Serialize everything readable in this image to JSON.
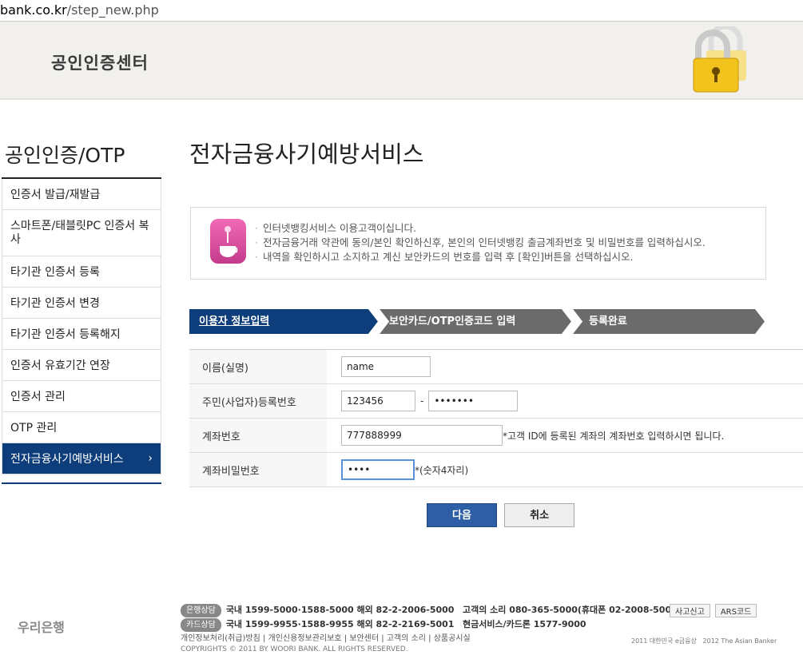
{
  "url": {
    "host": "bank.co.kr",
    "path": "/step_new.php"
  },
  "header": {
    "title": "공인인증센터"
  },
  "sidebar": {
    "title": "공인인증/OTP",
    "items": [
      "인증서 발급/재발급",
      "스마트폰/태블릿PC 인증서 복사",
      "타기관 인증서 등록",
      "타기관 인증서 변경",
      "타기관 인증서 등록해지",
      "인증서 유효기간 연장",
      "인증서 관리",
      "OTP 관리",
      "전자금융사기예방서비스"
    ]
  },
  "page": {
    "title": "전자금융사기예방서비스"
  },
  "info": {
    "lines": [
      "인터넷뱅킹서비스 이용고객이십니다.",
      "전자금융거래 약관에 동의/본인 확인하신후, 본인의 인터넷뱅킹 출금계좌번호 및 비밀번호를 입력하십시오.",
      "내역을 확인하시고 소지하고 계신 보안카드의 번호를 입력 후 [확인]버튼을 선택하십시오."
    ]
  },
  "steps": [
    "이용자 정보입력",
    "보안카드/OTP인증코드 입력",
    "등록완료"
  ],
  "form": {
    "name_label": "이름(실명)",
    "name_value": "name",
    "rrn_label": "주민(사업자)등록번호",
    "rrn_front": "123456",
    "rrn_sep": "-",
    "rrn_back": "•••••••",
    "account_label": "계좌번호",
    "account_value": "777888999",
    "account_note": "*고객 ID에 등록된 계좌의 계좌번호 입력하시면 됩니다.",
    "password_label": "계좌비밀번호",
    "password_value": "••••",
    "password_note": "*(숫자4자리)"
  },
  "buttons": {
    "next": "다음",
    "cancel": "취소"
  },
  "footer": {
    "logo": "우리은행",
    "bank_pill": "은행상담",
    "bank_line": "국내 1599-5000·1588-5000  해외 82-2-2006-5000",
    "card_pill": "카드상담",
    "card_line": "국내 1599-9955·1588-9955  해외 82-2-2169-5001",
    "voice": "고객의 소리  080-365-5000(휴대폰 02-2008-5000)",
    "cash": "현금서비스/카드론  1577-9000",
    "links": "개인정보처리(취급)방침 | 개인신용정보관리보호 | 보안센터 | 고객의 소리 | 상품공시실",
    "copyright": "COPYRIGHTS © 2011 BY WOORI BANK. ALL RIGHTS RESERVED.",
    "report_btn": "사고신고",
    "ars_btn": "ARS코드",
    "award1": "2011 대한민국 e금융상",
    "award2": "2012 The Asian Banker"
  }
}
